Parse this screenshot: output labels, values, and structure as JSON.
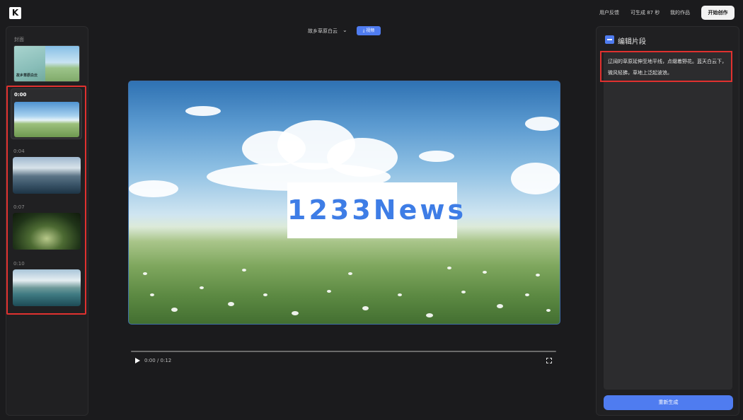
{
  "app": {
    "logo_text": "K"
  },
  "header": {
    "nav": {
      "feedback": "用户反馈",
      "credits": "可生成 87 秒",
      "my_works": "我的作品"
    },
    "start_label": "开始创作"
  },
  "sidebar": {
    "cover_label": "封面",
    "cover_title": "故乡草原白云",
    "segments": [
      {
        "time": "0:00",
        "active": true
      },
      {
        "time": "0:04",
        "active": false
      },
      {
        "time": "0:07",
        "active": false
      },
      {
        "time": "0:10",
        "active": false
      }
    ]
  },
  "player": {
    "title": "故乡草原白云",
    "download_label": "⤓ 视频",
    "watermark": "1233News",
    "current_time": "0:00",
    "duration": "0:12",
    "time_display": "0:00 / 0:12"
  },
  "editor": {
    "title": "编辑片段",
    "description": "辽阔的草原延伸至地平线，点缀着野花。蓝天白云下，微风轻拂，草地上泛起波浪。",
    "regenerate_label": "重新生成"
  },
  "colors": {
    "accent": "#4f7cf0",
    "highlight_red": "#e0312f",
    "background": "#1b1b1d",
    "panel": "#202022"
  }
}
